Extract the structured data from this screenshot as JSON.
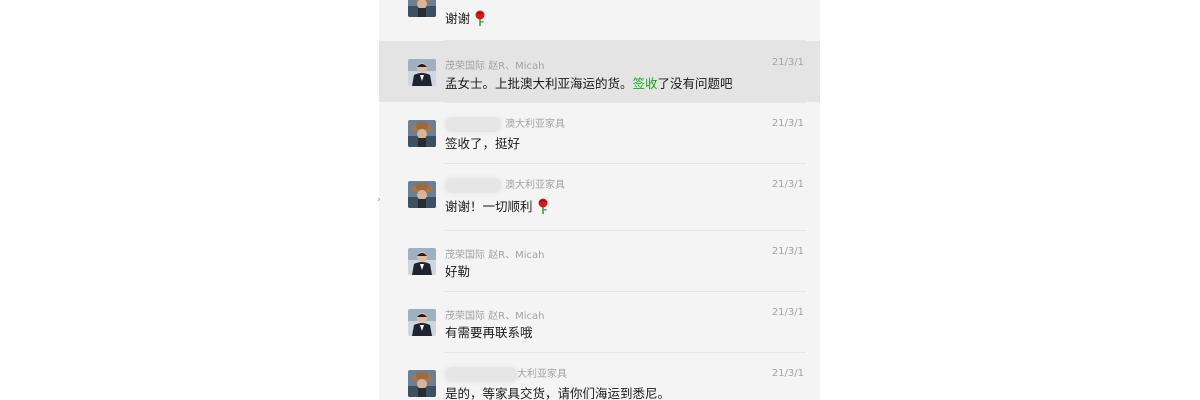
{
  "chat": {
    "messages": [
      {
        "avatar": "avatar-person-hat",
        "sender_visible": "",
        "time": "",
        "text": "谢谢",
        "emoji": "rose-emoji"
      },
      {
        "avatar": "avatar-person-suit",
        "sender_visible": "茂荣国际 赵R、Micah",
        "time": "21/3/1",
        "text_before": "孟女士。上批澳大利亚海运的货。",
        "text_highlight": "签收",
        "text_after": "了没有问题吧",
        "highlighted": true
      },
      {
        "avatar": "avatar-person-hat",
        "sender_visible": "澳大利亚家具",
        "sender_blurred": true,
        "time": "21/3/1",
        "text": "签收了，挺好"
      },
      {
        "avatar": "avatar-person-hat",
        "sender_visible": "澳大利亚家具",
        "sender_blurred": true,
        "time": "21/3/1",
        "text": "谢谢！一切顺利",
        "emoji": "rose-emoji"
      },
      {
        "avatar": "avatar-person-suit",
        "sender_visible": "茂荣国际 赵R、Micah",
        "time": "21/3/1",
        "text": "好勒"
      },
      {
        "avatar": "avatar-person-suit",
        "sender_visible": "茂荣国际 赵R、Micah",
        "time": "21/3/1",
        "text": "有需要再联系哦"
      },
      {
        "avatar": "avatar-person-hat",
        "sender_visible": "大利亚家具",
        "sender_blurred": true,
        "time": "21/3/1",
        "text": "是的，等家具交货，请你们海运到悉尼。"
      }
    ]
  },
  "colors": {
    "panel_bg": "#f4f4f4",
    "highlight_bg": "#e4e4e4",
    "link_green": "#1aad19",
    "meta_gray": "#a2a2a2"
  }
}
